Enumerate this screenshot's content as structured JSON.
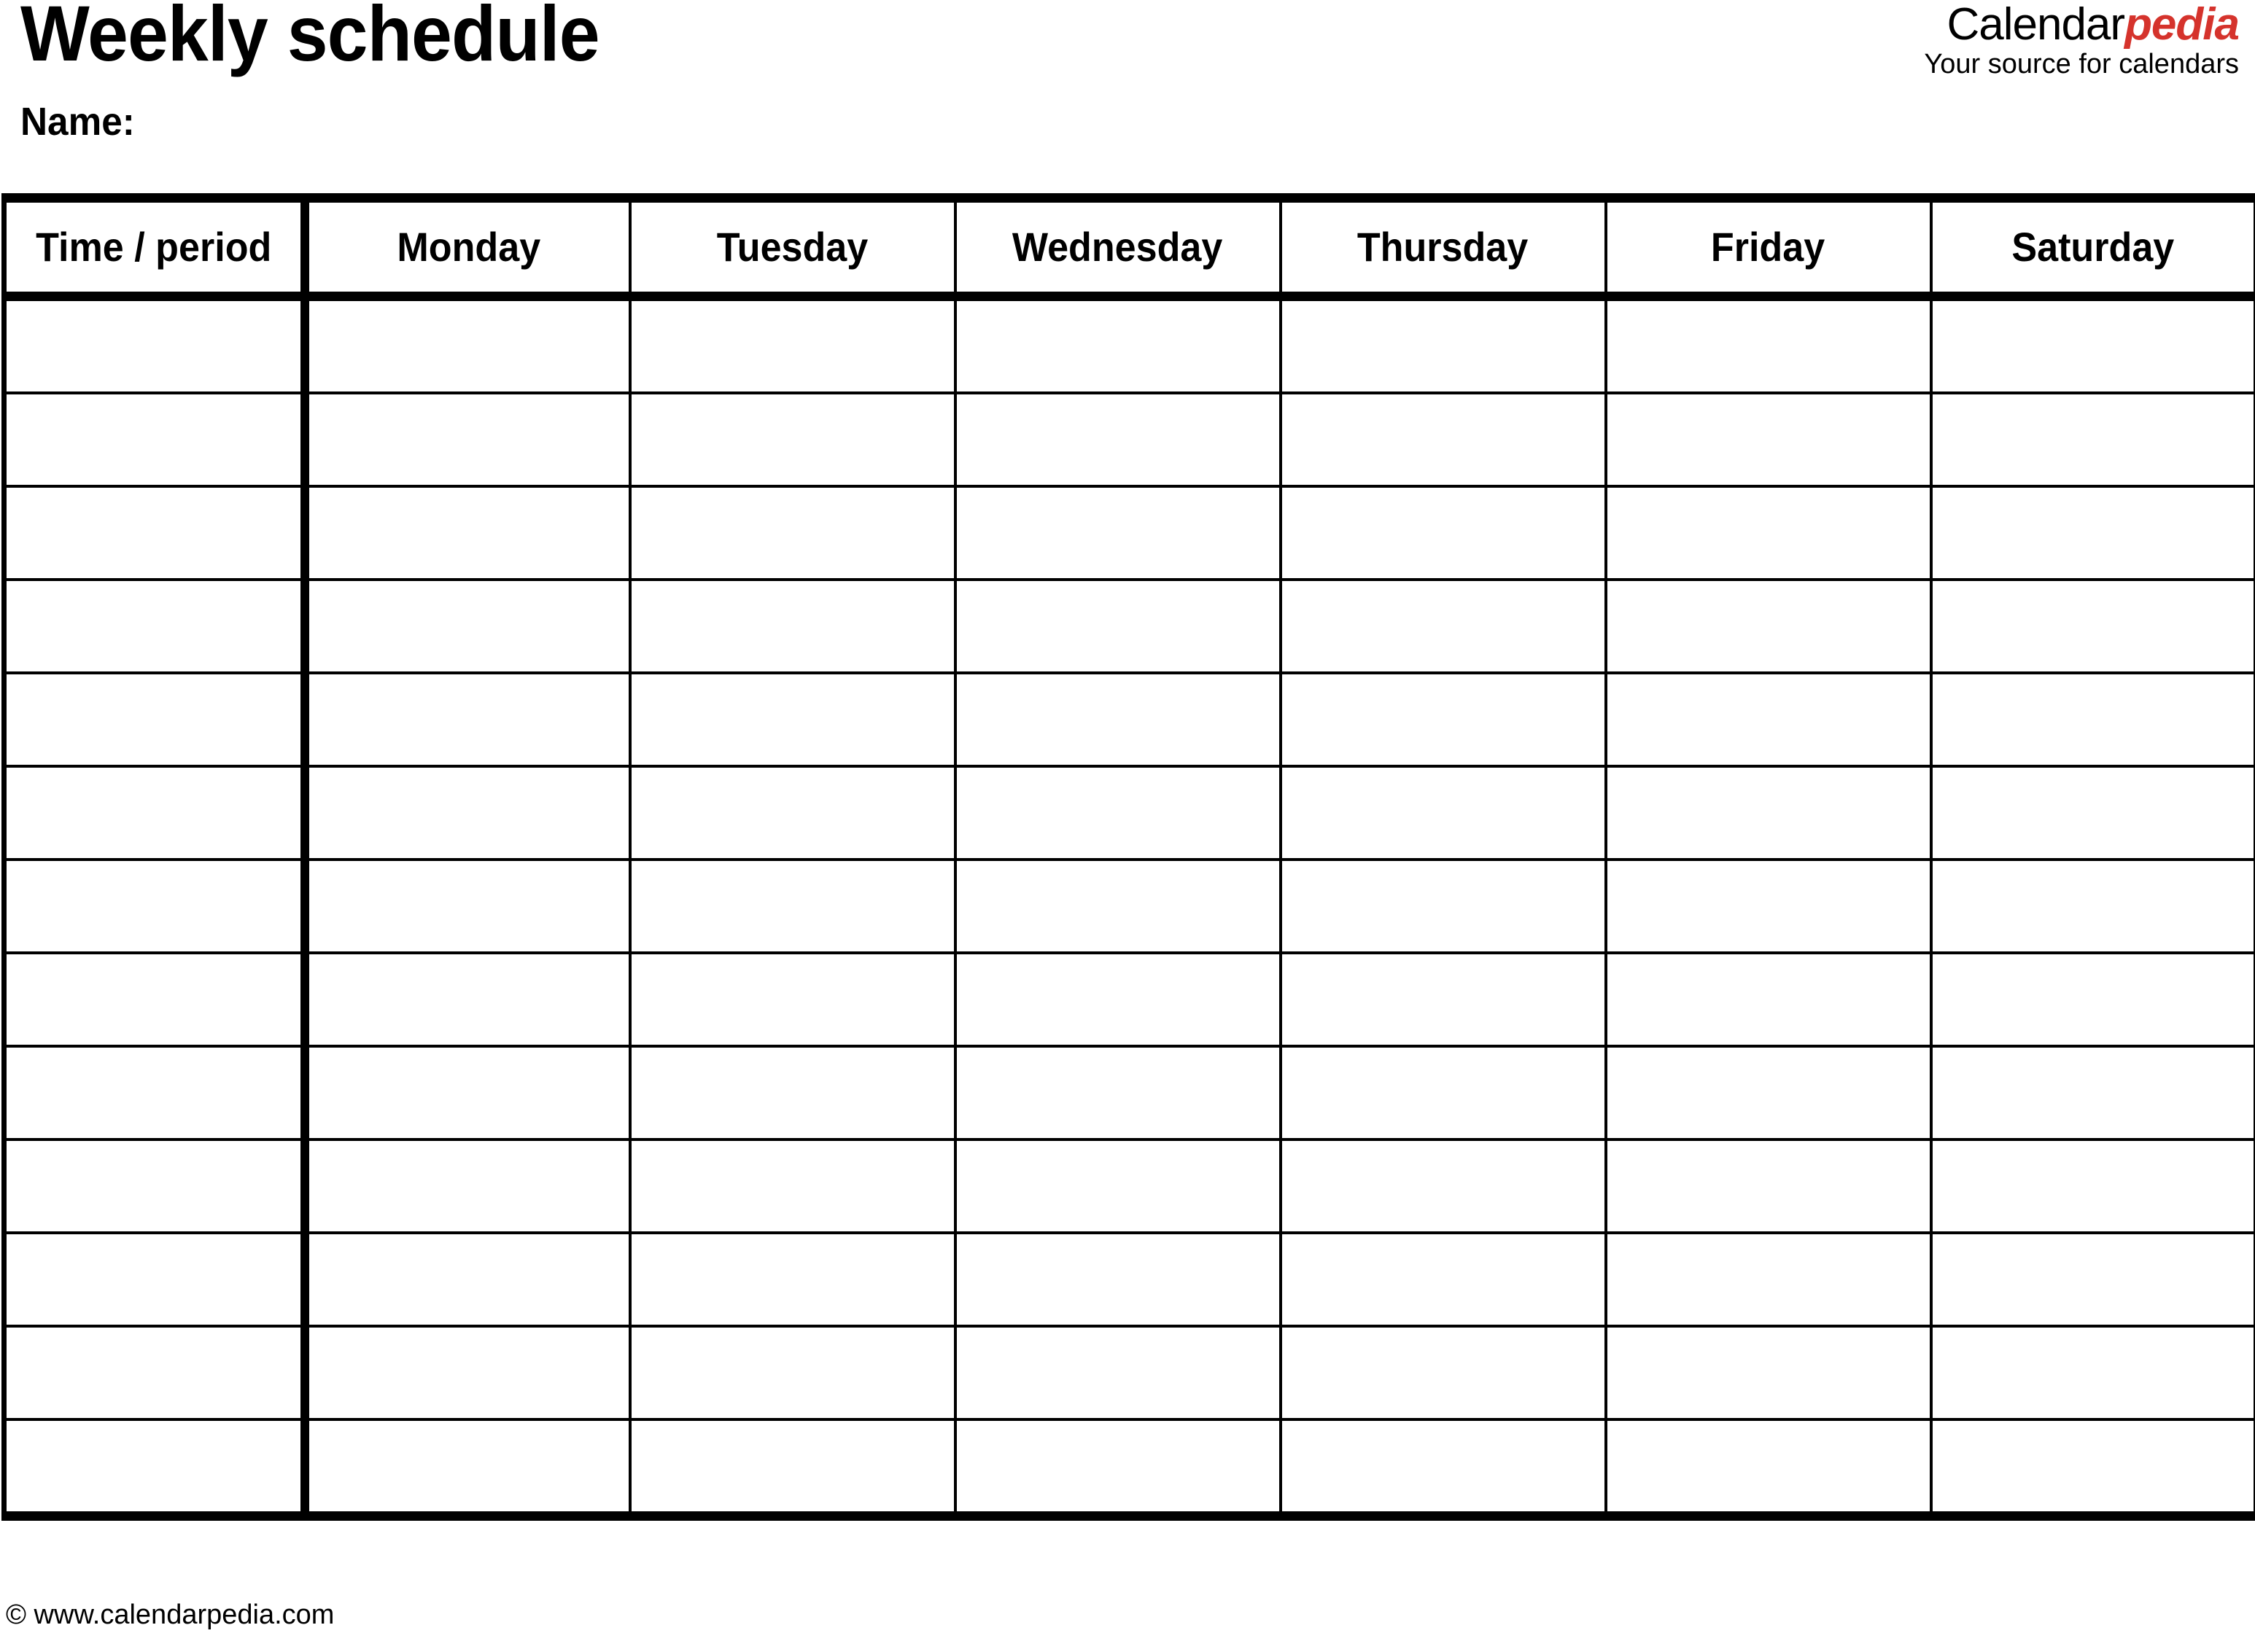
{
  "document": {
    "title": "Weekly schedule",
    "name_label": "Name:"
  },
  "brand": {
    "word_primary": "Calendar",
    "word_accent": "pedia",
    "tagline": "Your source for calendars",
    "accent_color": "#D5332C",
    "primary_color": "#000000"
  },
  "schedule": {
    "columns": [
      {
        "key": "time",
        "label": "Time / period"
      },
      {
        "key": "monday",
        "label": "Monday"
      },
      {
        "key": "tuesday",
        "label": "Tuesday"
      },
      {
        "key": "wednesday",
        "label": "Wednesday"
      },
      {
        "key": "thursday",
        "label": "Thursday"
      },
      {
        "key": "friday",
        "label": "Friday"
      },
      {
        "key": "saturday",
        "label": "Saturday"
      }
    ],
    "row_count": 13,
    "rows": [
      {
        "time": "",
        "monday": "",
        "tuesday": "",
        "wednesday": "",
        "thursday": "",
        "friday": "",
        "saturday": ""
      },
      {
        "time": "",
        "monday": "",
        "tuesday": "",
        "wednesday": "",
        "thursday": "",
        "friday": "",
        "saturday": ""
      },
      {
        "time": "",
        "monday": "",
        "tuesday": "",
        "wednesday": "",
        "thursday": "",
        "friday": "",
        "saturday": ""
      },
      {
        "time": "",
        "monday": "",
        "tuesday": "",
        "wednesday": "",
        "thursday": "",
        "friday": "",
        "saturday": ""
      },
      {
        "time": "",
        "monday": "",
        "tuesday": "",
        "wednesday": "",
        "thursday": "",
        "friday": "",
        "saturday": ""
      },
      {
        "time": "",
        "monday": "",
        "tuesday": "",
        "wednesday": "",
        "thursday": "",
        "friday": "",
        "saturday": ""
      },
      {
        "time": "",
        "monday": "",
        "tuesday": "",
        "wednesday": "",
        "thursday": "",
        "friday": "",
        "saturday": ""
      },
      {
        "time": "",
        "monday": "",
        "tuesday": "",
        "wednesday": "",
        "thursday": "",
        "friday": "",
        "saturday": ""
      },
      {
        "time": "",
        "monday": "",
        "tuesday": "",
        "wednesday": "",
        "thursday": "",
        "friday": "",
        "saturday": ""
      },
      {
        "time": "",
        "monday": "",
        "tuesday": "",
        "wednesday": "",
        "thursday": "",
        "friday": "",
        "saturday": ""
      },
      {
        "time": "",
        "monday": "",
        "tuesday": "",
        "wednesday": "",
        "thursday": "",
        "friday": "",
        "saturday": ""
      },
      {
        "time": "",
        "monday": "",
        "tuesday": "",
        "wednesday": "",
        "thursday": "",
        "friday": "",
        "saturday": ""
      },
      {
        "time": "",
        "monday": "",
        "tuesday": "",
        "wednesday": "",
        "thursday": "",
        "friday": "",
        "saturday": ""
      }
    ]
  },
  "footer": {
    "copyright": "© www.calendarpedia.com"
  }
}
